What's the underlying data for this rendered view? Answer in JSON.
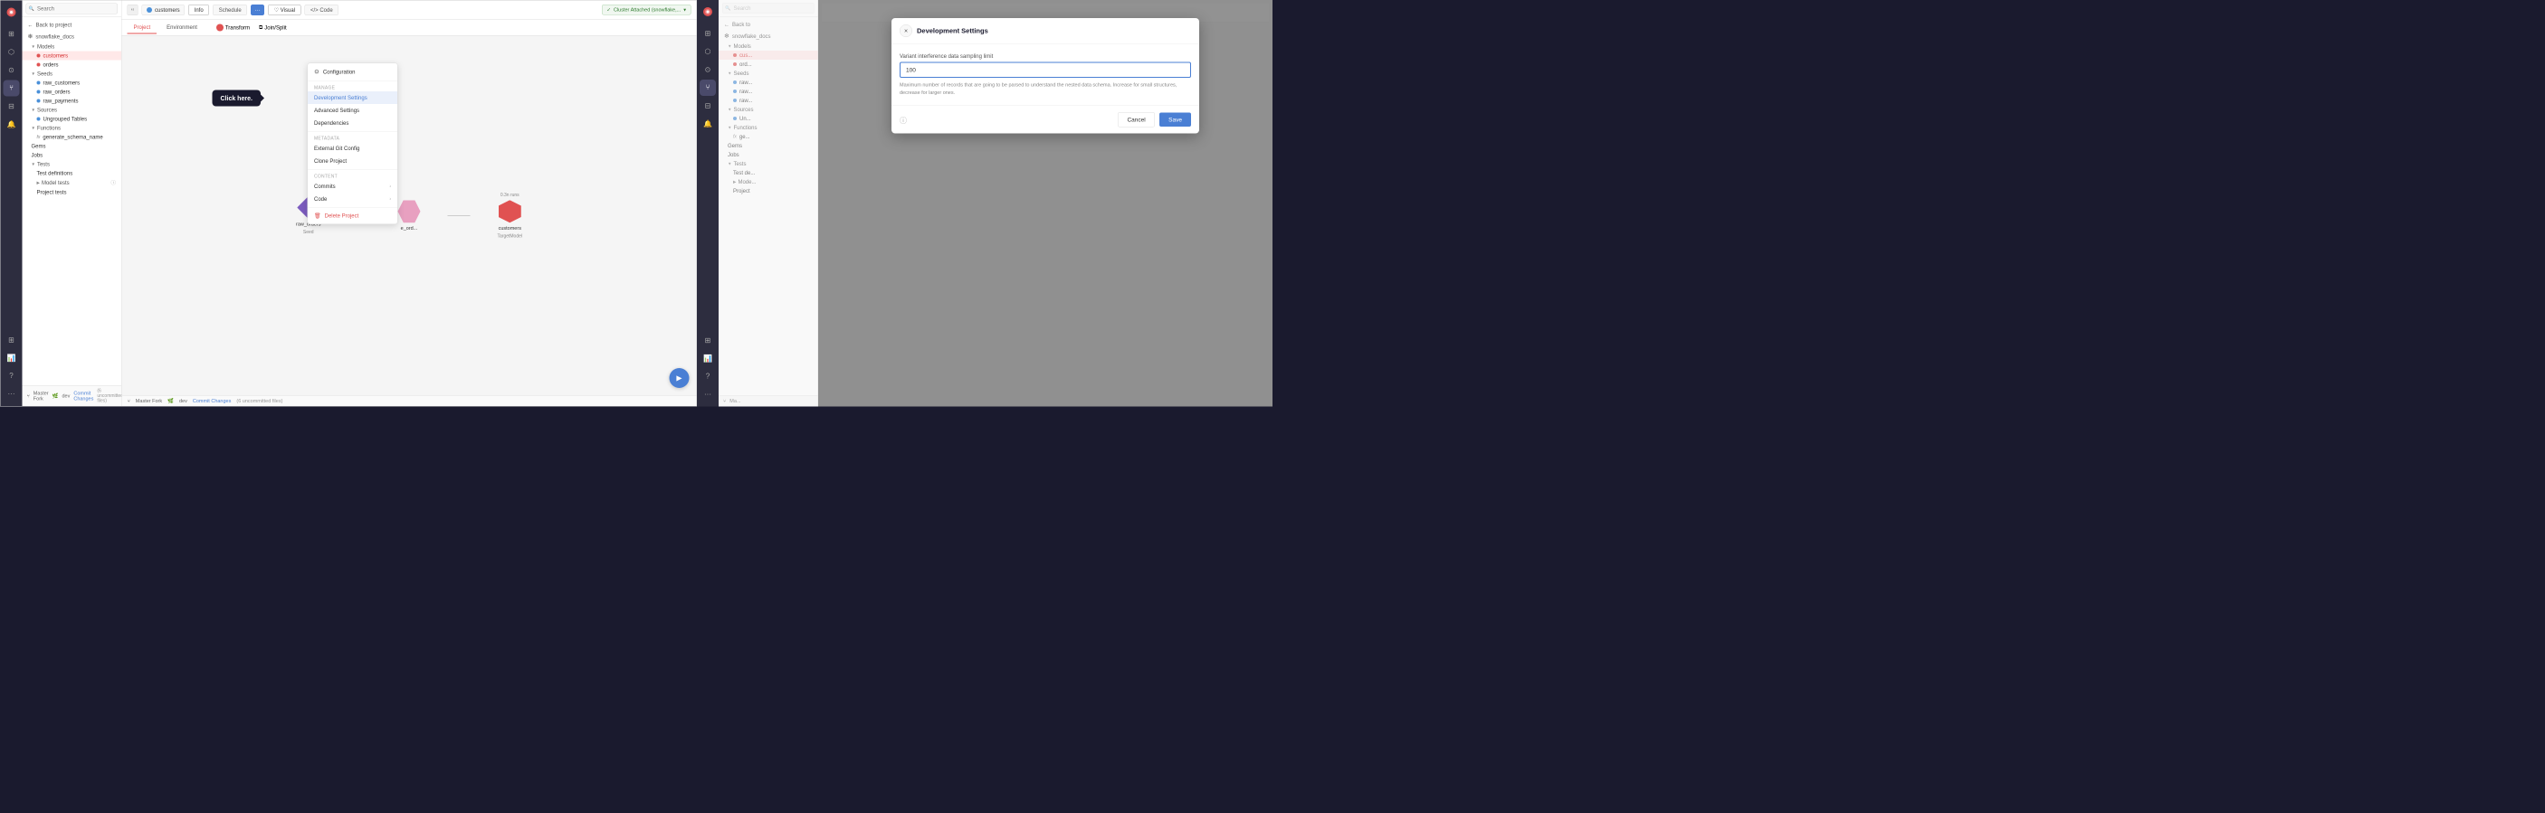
{
  "colors": {
    "accent": "#4a7fd4",
    "danger": "#e05252",
    "sidebar_bg": "#2d2d3f",
    "success": "#2d7a2d"
  },
  "left_panel": {
    "search_placeholder": "Search",
    "project_label": "customers",
    "info_tab": "Info",
    "schedule_tab": "Schedule",
    "more_tab": "···",
    "visual_tab": "Visual",
    "code_tab": "Code",
    "project_btn": "Project",
    "environment_btn": "Environment",
    "transform_btn": "Transform",
    "joinsplit_btn": "Join/Split",
    "cluster_status": "Cluster Attached (snowflake,...",
    "back_label": "Back to project",
    "project_name": "snowflake_docs",
    "models_label": "Models",
    "customers_item": "customers",
    "orders_item": "orders",
    "seeds_label": "Seeds",
    "raw_customers": "raw_customers",
    "raw_orders": "raw_orders",
    "raw_payments": "raw_payments",
    "sources_label": "Sources",
    "ungrouped_tables": "Ungrouped Tables",
    "functions_label": "Functions",
    "generate_schema_name": "generate_schema_name",
    "gems_label": "Gems",
    "jobs_label": "Jobs",
    "tests_label": "Tests",
    "test_definitions": "Test definitions",
    "model_tests": "Model tests",
    "project_tests": "Project tests",
    "branch_label": "Master Fork",
    "dev_label": "dev",
    "commit_label": "Commit Changes",
    "uncommitted": "(6 uncommitted files)"
  },
  "dropdown": {
    "section_manage": "Manage",
    "configuration": "Configuration",
    "development_settings": "Development Settings",
    "advanced_settings": "Advanced Settings",
    "dependencies": "Dependencies",
    "section_metadata": "Metadata",
    "external_git_config": "External Git Config",
    "clone_project": "Clone Project",
    "section_content": "Content",
    "commits": "Commits",
    "code": "Code",
    "delete_project": "Delete Project"
  },
  "tooltip": {
    "text": "Click here."
  },
  "canvas": {
    "seed_label": "Seed",
    "seed_node": "raw_orders",
    "agg_node": "e_ord...",
    "target_node": "customers",
    "target_runs": "0.3n runs",
    "run_icon": "▶"
  },
  "status_bar": {
    "branch": "Master Fork",
    "dev": "dev",
    "commit": "Commit Changes",
    "uncommitted": "(6 uncommitted files)"
  },
  "modal": {
    "title": "Development Settings",
    "close_icon": "×",
    "field_label": "Variant interference data sampling limit",
    "field_value": "100",
    "hint": "Maximum number of records that are going to be parsed to understand the nested data schema. Increase for small structures, decrease for larger ones.",
    "cancel_label": "Cancel",
    "save_label": "Save"
  },
  "right_panel": {
    "back_label": "Back to",
    "project_name": "snowflake_docs (partial)",
    "models_label": "Models",
    "seeds_label": "Seeds",
    "sources_label": "Sources",
    "functions_label": "Functions",
    "gems_label": "Gems",
    "jobs_label": "Jobs",
    "tests_label": "Tests",
    "project_tests": "Project",
    "branch": "Ma..."
  }
}
